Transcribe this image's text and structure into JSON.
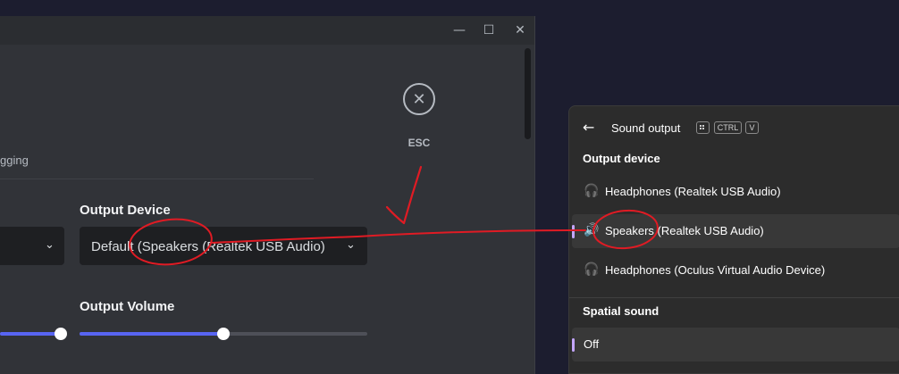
{
  "discord": {
    "esc_label": "ESC",
    "tab_fragment": "gging",
    "input_device_label": "",
    "output_device_label": "Output Device",
    "output_device_value": "Default (Speakers (Realtek USB Audio)",
    "output_volume_label": "Output Volume",
    "input_volume_fraction": 1.0,
    "output_volume_fraction": 0.5
  },
  "flyout": {
    "title": "Sound output",
    "shortcut_keys": [
      "CTRL",
      "V"
    ],
    "output_device_header": "Output device",
    "devices": [
      {
        "label": "Headphones (Realtek USB Audio)",
        "icon": "headphones-icon",
        "selected": false
      },
      {
        "label": "Speakers (Realtek USB Audio)",
        "icon": "speaker-icon",
        "selected": true
      },
      {
        "label": "Headphones (Oculus Virtual Audio Device)",
        "icon": "headphones-icon",
        "selected": false
      }
    ],
    "spatial_header": "Spatial sound",
    "spatial_value": "Off"
  },
  "colors": {
    "annotation": "#e01b24",
    "slider_accent": "#5865f2",
    "flyout_accent": "#c4a6ff"
  }
}
